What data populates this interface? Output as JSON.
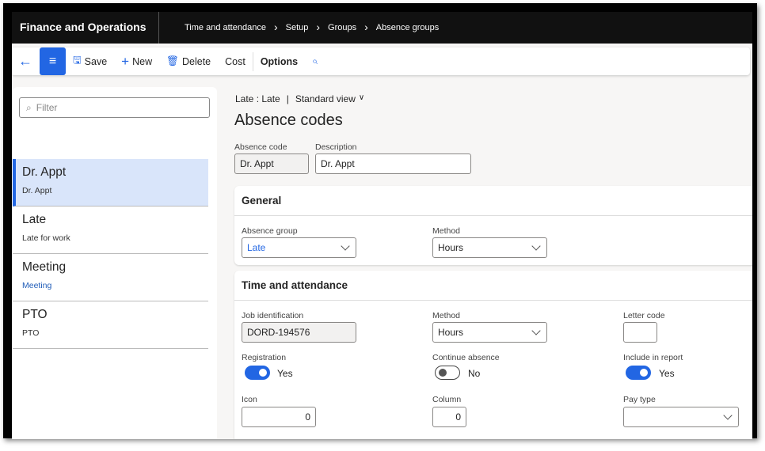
{
  "header": {
    "app_title": "Finance and Operations",
    "breadcrumbs": [
      "Time and attendance",
      "Setup",
      "Groups",
      "Absence groups"
    ]
  },
  "toolbar": {
    "save": "Save",
    "new": "New",
    "delete": "Delete",
    "cost": "Cost",
    "options": "Options"
  },
  "list": {
    "filter_placeholder": "Filter",
    "items": [
      {
        "title": "Dr. Appt",
        "subtitle": "Dr. Appt"
      },
      {
        "title": "Late",
        "subtitle": "Late for work"
      },
      {
        "title": "Meeting",
        "subtitle": "Meeting"
      },
      {
        "title": "PTO",
        "subtitle": "PTO"
      }
    ]
  },
  "detail": {
    "record": "Late : Late",
    "view": "Standard view",
    "title": "Absence codes",
    "absence_code_label": "Absence code",
    "absence_code": "Dr. Appt",
    "description_label": "Description",
    "description": "Dr. Appt",
    "general": {
      "title": "General",
      "absence_group_label": "Absence group",
      "absence_group": "Late",
      "method_label": "Method",
      "method": "Hours"
    },
    "ta": {
      "title": "Time and attendance",
      "job_label": "Job identification",
      "job": "DORD-194576",
      "method_label": "Method",
      "method": "Hours",
      "letter_label": "Letter code",
      "letter": "",
      "registration_label": "Registration",
      "registration": "Yes",
      "continue_label": "Continue absence",
      "continue": "No",
      "include_label": "Include in report",
      "include": "Yes",
      "icon_label": "Icon",
      "icon": "0",
      "column_label": "Column",
      "column": "0",
      "pay_label": "Pay type",
      "pay": ""
    }
  }
}
